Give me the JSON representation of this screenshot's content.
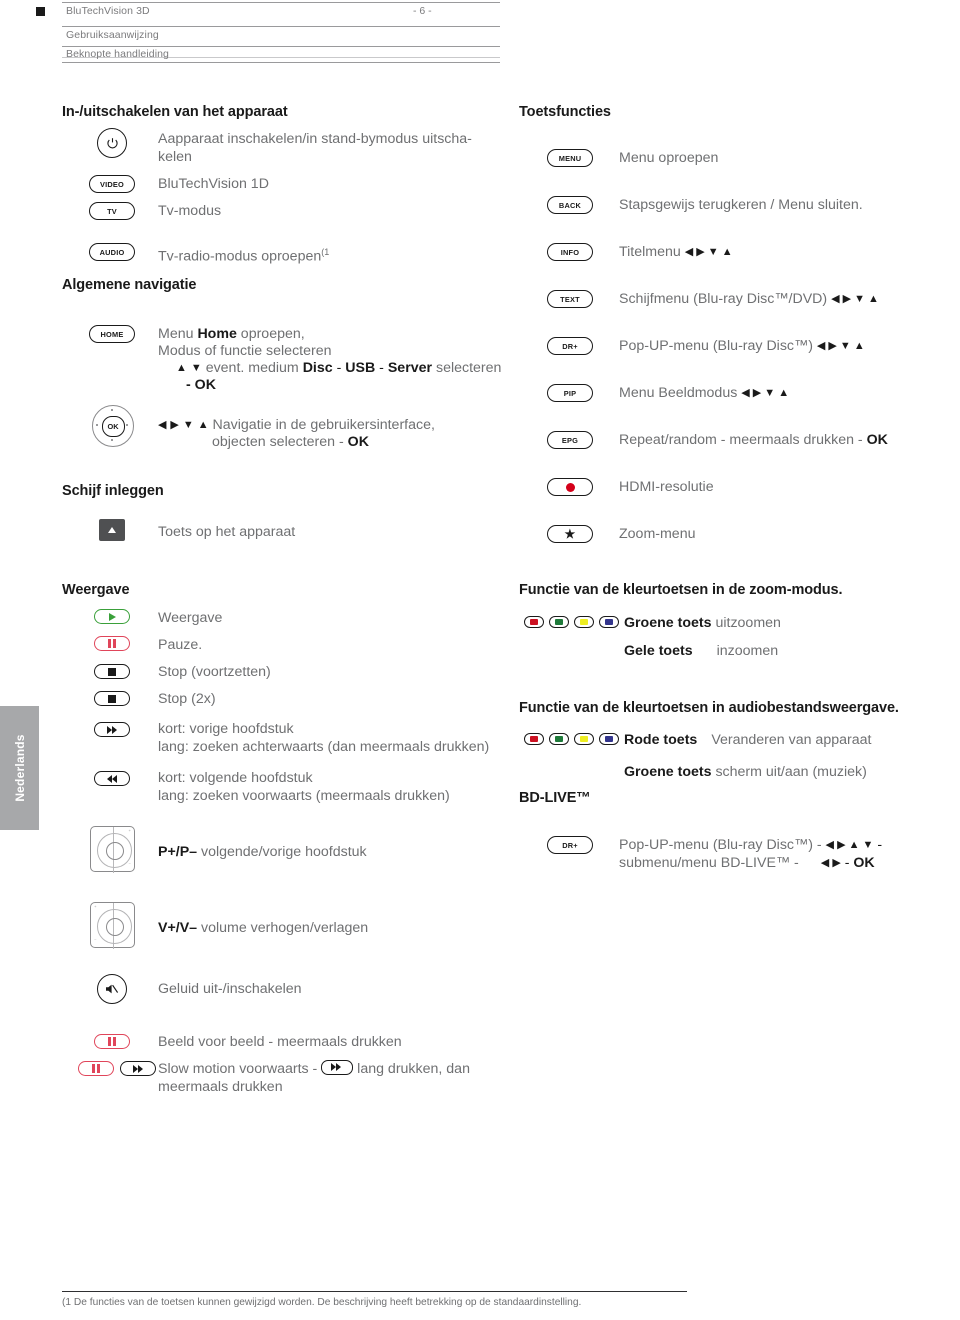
{
  "header": {
    "product": "BluTechVision 3D",
    "line2": "Gebruiksaanwijzing",
    "line3": "Beknopte handleiding",
    "page_number": "- 6 -"
  },
  "side_tab": {
    "label": "Nederlands"
  },
  "sections": {
    "power": {
      "title": "In-/uitschakelen van het apparaat",
      "rows": [
        {
          "key": "power-icon",
          "text_line1": "Aapparaat inschakelen/in stand-bymodus uitscha-",
          "text_line2": "kelen"
        },
        {
          "key": "VIDEO",
          "text_line1": "BluTechVision 1D"
        },
        {
          "key": "TV",
          "text_line1": "Tv-modus"
        },
        {
          "key": "AUDIO",
          "text_line1": "Tv-radio-modus oproepen",
          "footnote": "(1"
        }
      ]
    },
    "navigation": {
      "title": "Algemene navigatie",
      "home_key": "HOME",
      "home_l1_a": "Menu ",
      "home_l1_b": "Home",
      "home_l1_c": " oproepen,",
      "home_l2": "Modus of functie selecteren",
      "home_l3_a": "event. medium ",
      "home_l3_b": "Disc",
      "home_l3_c": " - ",
      "home_l3_d": "USB",
      "home_l3_e": " - ",
      "home_l3_f": "Server",
      "home_l3_g": " selecteren",
      "home_l4": "- OK",
      "ok_key": "OK",
      "ok_l1": "Navigatie in de gebruikersinterface,",
      "ok_l2_a": "objecten selecteren - ",
      "ok_l2_b": "OK"
    },
    "disc": {
      "title": "Schijf inleggen",
      "key": "eject-icon",
      "text": "Toets op het apparaat"
    },
    "playback": {
      "title": "Weergave",
      "rows": [
        {
          "key": "play-icon",
          "color": "#3aa03a",
          "text_line1": "Weergave"
        },
        {
          "key": "pause-icon",
          "color": "#e0455a",
          "text_line1": "Pauze."
        },
        {
          "key": "stop-icon",
          "color": "#1a1a1a",
          "text_line1": "Stop (voortzetten)"
        },
        {
          "key": "stop-icon",
          "color": "#1a1a1a",
          "text_line1": "Stop (2x)"
        },
        {
          "key": "fast-forward-icon",
          "color": "#1a1a1a",
          "text_line1": "kort: vorige hoofdstuk",
          "text_line2": "lang: zoeken achterwaarts (dan meermaals drukken)"
        },
        {
          "key": "rewind-icon",
          "color": "#1a1a1a",
          "text_line1": "kort: volgende hoofdstuk",
          "text_line2": "lang: zoeken voorwaarts (meermaals drukken)"
        }
      ],
      "rocker_program": {
        "label": "P+/P–",
        "text": " volgende/vorige hoofdstuk"
      },
      "rocker_volume": {
        "label": "V+/V–",
        "text": " volume verhogen/verlagen"
      },
      "mute": {
        "key": "mute-icon",
        "text": "Geluid uit-/inschakelen"
      },
      "frame_step": {
        "key": "pause-icon",
        "text": "Beeld voor beeld - meermaals drukken"
      },
      "slow_motion": {
        "key1": "pause-icon",
        "key2": "fast-forward-icon",
        "text_a": "Slow motion voorwaarts - ",
        "text_b": " lang drukken, dan",
        "text_line2": "meermaals drukken"
      }
    },
    "key_functions": {
      "title": "Toetsfuncties",
      "rows": [
        {
          "key": "MENU",
          "text": "Menu oproepen",
          "arrows": ""
        },
        {
          "key": "BACK",
          "text": " Stapsgewijs terugkeren / Menu sluiten.",
          "arrows": ""
        },
        {
          "key": "INFO",
          "text": "Titelmenu ",
          "arrows": "◀ ▶ ▼ ▲"
        },
        {
          "key": "TEXT",
          "text": "Schijfmenu (Blu-ray Disc™/DVD) ",
          "arrows": "◀ ▶ ▼ ▲"
        },
        {
          "key": "DR+",
          "text": "Pop-UP-menu (Blu-ray Disc™) ",
          "arrows": "◀ ▶ ▼ ▲"
        },
        {
          "key": "PIP",
          "text": "Menu Beeldmodus ",
          "arrows": "◀ ▶ ▼ ▲"
        },
        {
          "key": "EPG",
          "text": "Repeat/random - meermaals drukken - ",
          "bold_tail": "OK",
          "arrows": ""
        },
        {
          "key": "record-dot-icon",
          "text": "HDMI-resolutie",
          "arrows": ""
        },
        {
          "key": "star-icon",
          "text": "Zoom-menu",
          "arrows": ""
        }
      ]
    },
    "zoom_mode": {
      "title": "Functie van de kleurtoetsen in de zoom-modus.",
      "row1_bold": "Groene toets",
      "row1_text": " uitzoomen",
      "row2_bold": "Gele toets",
      "row2_text": "inzoomen"
    },
    "audio_mode": {
      "title": "Functie van de kleurtoetsen in audiobestandsweergave.",
      "row1_bold": "Rode toets",
      "row1_text": "Veranderen van apparaat",
      "row2_bold": "Groene toets",
      "row2_text": " scherm uit/aan (muziek)"
    },
    "bdlive": {
      "title": "BD-LIVE™",
      "key": "DR+",
      "line1_a": "Pop-UP-menu (Blu-ray Disc™) - ",
      "line1_arrows": "◀ ▶ ▲ ▼",
      "line1_b": " -",
      "line2_a": "submenu/menu BD-LIVE™ -",
      "line2_arrows": "◀ ▶",
      "line2_b": " - ",
      "line2_bold": "OK"
    }
  },
  "colors": {
    "red": "#cc1122",
    "green": "#1f7a3a",
    "yellow": "#eeee22",
    "blue": "#33358c",
    "record_red": "#d4001a",
    "tab_gray": "#a7a8aa",
    "body_text": "#6f7072",
    "heading": "#1a1a1a"
  },
  "footer": {
    "note": "(1 De functies van de toetsen kunnen gewijzigd worden. De beschrijving heeft betrekking op de standaardinstelling."
  }
}
